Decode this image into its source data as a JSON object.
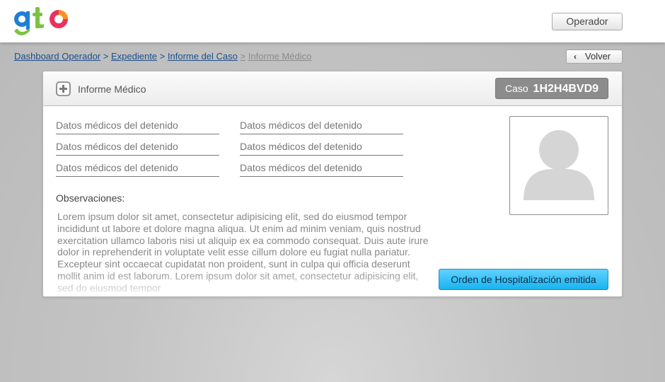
{
  "header": {
    "logo_text": "gto",
    "operador_label": "Operador"
  },
  "breadcrumb": {
    "items": [
      "Dashboard Operador",
      "Expediente",
      "Informe del Caso"
    ],
    "separator": ">",
    "current": "Informe Médico"
  },
  "volver": {
    "label": "Volver",
    "icon": "chevron-left-icon"
  },
  "panel": {
    "title": "Informe Médico",
    "icon": "plus-icon",
    "case_prefix": "Caso",
    "case_number": "1H2H4BVD9"
  },
  "fields": {
    "left": [
      "Datos médicos del detenido",
      "Datos médicos del detenido",
      "Datos médicos del detenido"
    ],
    "right": [
      "Datos médicos del detenido",
      "Datos médicos del detenido",
      "Datos médicos del detenido"
    ]
  },
  "observaciones": {
    "label": "Observaciones:",
    "text": "Lorem ipsum dolor sit amet, consectetur adipisicing elit, sed do eiusmod tempor incididunt ut labore et dolore magna aliqua. Ut enim ad minim veniam, quis nostrud exercitation ullamco laboris nisi ut aliquip ex ea commodo consequat. Duis aute irure dolor in reprehenderit in voluptate velit esse cillum dolore eu fugiat nulla pariatur. Excepteur sint occaecat cupidatat non proident, sunt in culpa qui officia deserunt mollit anim id est laborum. Lorem ipsum dolor sit amet, consectetur adipisicing elit, sed do eiusmod tempor"
  },
  "photo": {
    "icon": "user-avatar-placeholder-icon"
  },
  "hospitalization_button": "Orden de Hospitalización emitida",
  "colors": {
    "logo_blue": "#1f7fd6",
    "logo_green": "#7cc242",
    "logo_pink": "#e8335f",
    "logo_orange": "#f7931e",
    "link": "#1d4f8a",
    "case_badge": "#8c8c8c",
    "accent_button": "#19b3ef"
  }
}
